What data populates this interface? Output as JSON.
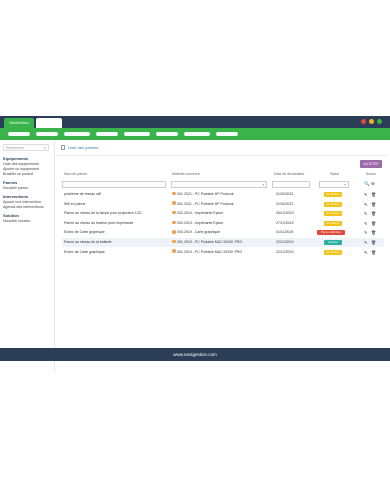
{
  "window": {
    "app_tab": "NextGestion",
    "controls_colors": [
      "#e04a3f",
      "#f0b429",
      "#39b34a"
    ]
  },
  "sidebar": {
    "search_placeholder": "Rechercher",
    "sections": [
      {
        "title": "Equipements",
        "items": [
          "Liste des équipements",
          "Ajouter un équipement",
          "Brasiller un produit"
        ]
      },
      {
        "title": "Pannes",
        "items": [
          "Nouvelle panne"
        ]
      },
      {
        "title": "Interventions",
        "items": [
          "Ajouter une intervention",
          "Agenda des interventions"
        ]
      },
      {
        "title": "Solution",
        "items": [
          "Nouvelle solution"
        ]
      }
    ]
  },
  "main": {
    "breadcrumb": "Liste des pannes",
    "add_button": "AJOUTER",
    "columns": [
      "Nom de panne",
      "Matériel concerné",
      "Date de déclaration",
      "Statut",
      "Action"
    ],
    "rows": [
      {
        "name": "problème de réseau wifi",
        "material": "001-2021 - PC Portable HP Probook",
        "date": "01/02/2021",
        "status": "En attente",
        "status_color": "#f0c419"
      },
      {
        "name": "Wifi en panne",
        "material": "001-2021 - PC Portable HP Probook",
        "date": "01/02/2021",
        "status": "En attente",
        "status_color": "#f0c419"
      },
      {
        "name": "Panne au niveau de la lampe pour projecteur LCD",
        "material": "002-2019 - Imprimante Epson",
        "date": "30/12/2019",
        "status": "En attente",
        "status_color": "#f0c419"
      },
      {
        "name": "Panne au niveau du tradeur pour imprimante",
        "material": "002-2019 - Imprimante Epson",
        "date": "27/12/2019",
        "status": "En attente",
        "status_color": "#f0c419"
      },
      {
        "name": "Echec de Carte graphique",
        "material": "003-2019 - Carte graphique",
        "date": "01/11/2019",
        "status": "Panne définitive",
        "status_color": "#e04a3f"
      },
      {
        "name": "Panne au niveau de la batterie",
        "material": "001-2019 - PC Portable MAC BOOK PRO",
        "date": "22/12/2019",
        "status": "Réparé",
        "status_color": "#2bb0a0"
      },
      {
        "name": "Echec de Carte graphique",
        "material": "001-2019 - PC Portable MAC BOOK PRO",
        "date": "22/12/2019",
        "status": "En attente",
        "status_color": "#f0c419"
      }
    ]
  },
  "footer": {
    "text": "www.nextgestion.com"
  },
  "colors": {
    "titlebar": "#2b3d57",
    "navbar": "#39b34a",
    "accent_button": "#9b6aa8",
    "footer": "#2b3d57"
  }
}
